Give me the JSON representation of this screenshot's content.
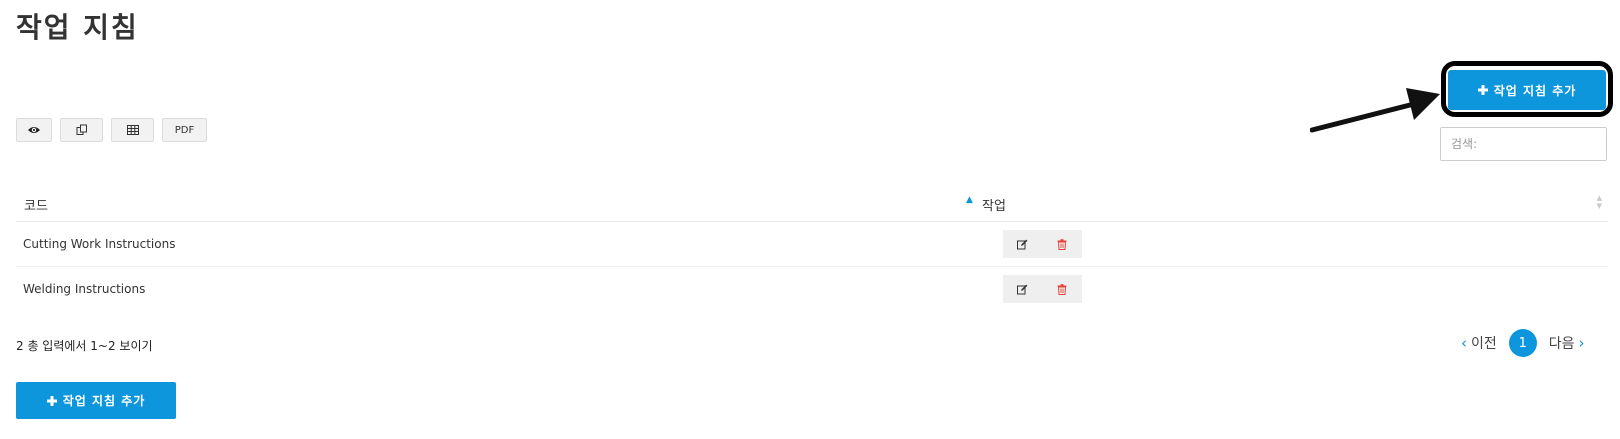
{
  "page": {
    "title": "작업 지침"
  },
  "toolbar": {
    "buttons": [
      {
        "name": "view-button",
        "icon": "eye-icon",
        "label": ""
      },
      {
        "name": "copy-button",
        "icon": "copy-icon",
        "label": ""
      },
      {
        "name": "excel-button",
        "icon": "table-icon",
        "label": ""
      },
      {
        "name": "pdf-button",
        "icon": "",
        "label": "PDF"
      }
    ],
    "add_label": "작업 지침 추가",
    "add_icon": "plus-icon"
  },
  "search": {
    "placeholder": "검색:",
    "value": ""
  },
  "table": {
    "columns": [
      "코드",
      "작업"
    ],
    "rows": [
      {
        "code": "Cutting Work Instructions"
      },
      {
        "code": "Welding Instructions"
      }
    ]
  },
  "footer": {
    "info": "2 총 입력에서 1~2 보이기",
    "pagination": {
      "prev": "이전",
      "current": "1",
      "next": "다음"
    },
    "add_label": "작업 지침 추가"
  },
  "colors": {
    "accent": "#0d96dc",
    "delete": "#e0433c",
    "text": "#333333"
  }
}
